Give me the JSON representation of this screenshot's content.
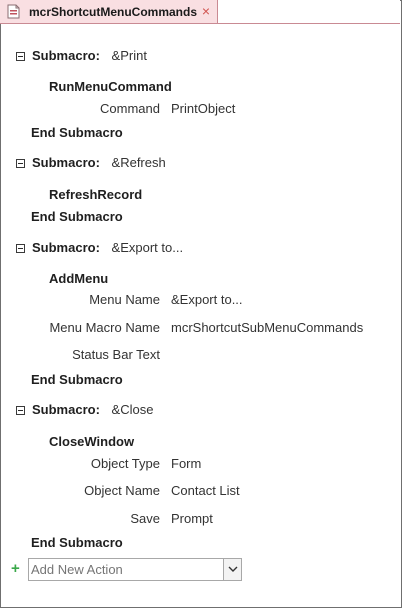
{
  "tab": {
    "title": "mcrShortcutMenuCommands",
    "close_glyph": "×"
  },
  "submacros": [
    {
      "keyword": "Submacro:",
      "name": "&Print",
      "action": "RunMenuCommand",
      "args": [
        {
          "name": "Command",
          "value": "PrintObject"
        }
      ],
      "end": "End Submacro"
    },
    {
      "keyword": "Submacro:",
      "name": "&Refresh",
      "action": "RefreshRecord",
      "args": [],
      "end": "End Submacro"
    },
    {
      "keyword": "Submacro:",
      "name": "&Export to...",
      "action": "AddMenu",
      "args": [
        {
          "name": "Menu Name",
          "value": "&Export to..."
        },
        {
          "name": "Menu Macro Name",
          "value": "mcrShortcutSubMenuCommands"
        },
        {
          "name": "Status Bar Text",
          "value": ""
        }
      ],
      "end": "End Submacro"
    },
    {
      "keyword": "Submacro:",
      "name": "&Close",
      "action": "CloseWindow",
      "args": [
        {
          "name": "Object Type",
          "value": "Form"
        },
        {
          "name": "Object Name",
          "value": "Contact List"
        },
        {
          "name": "Save",
          "value": "Prompt"
        }
      ],
      "end": "End Submacro"
    }
  ],
  "add_action": {
    "plus_glyph": "+",
    "placeholder": "Add New Action"
  },
  "colors": {
    "tab_bg": "#f9dfe2",
    "tab_close": "#d0534f",
    "add_plus": "#3aa84a"
  },
  "icons": {
    "tab": "macro-document-icon",
    "collapse": "collapse-minus-icon",
    "dropdown": "chevron-down-icon"
  }
}
